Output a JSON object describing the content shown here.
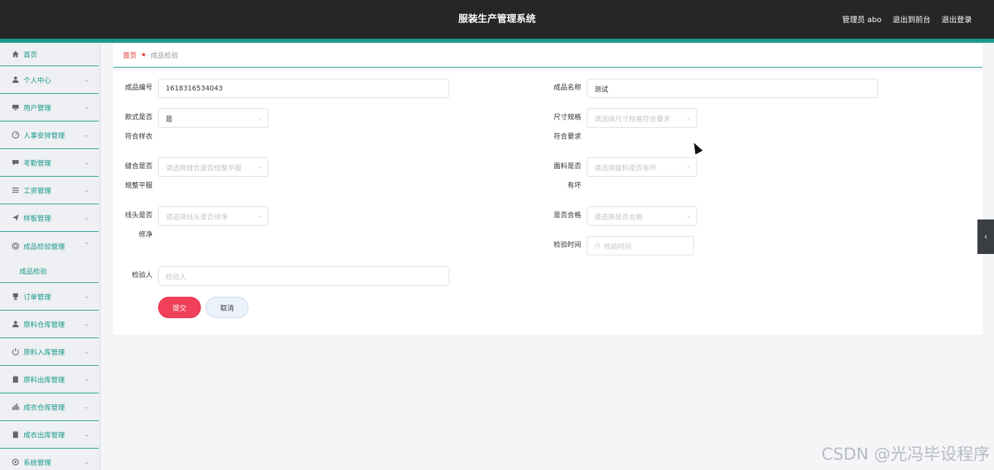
{
  "header": {
    "title": "服装生产管理系统",
    "links": [
      "管理员 abo",
      "退出到前台",
      "退出登录"
    ]
  },
  "sidebar": {
    "items": [
      {
        "label": "首页",
        "icon": "home-icon"
      },
      {
        "label": "个人中心",
        "icon": "user-icon"
      },
      {
        "label": "用户管理",
        "icon": "monitor-icon"
      },
      {
        "label": "人事安排管理",
        "icon": "dashboard-icon"
      },
      {
        "label": "考勤管理",
        "icon": "chat-icon"
      },
      {
        "label": "工资管理",
        "icon": "list-icon"
      },
      {
        "label": "样板管理",
        "icon": "send-icon"
      },
      {
        "label": "成品检验管理",
        "icon": "target-icon"
      },
      {
        "label": "订单管理",
        "icon": "cup-icon"
      },
      {
        "label": "原料仓库管理",
        "icon": "user-icon"
      },
      {
        "label": "原料入库管理",
        "icon": "power-icon"
      },
      {
        "label": "原料出库管理",
        "icon": "clipboard-icon"
      },
      {
        "label": "成衣仓库管理",
        "icon": "chart-icon"
      },
      {
        "label": "成衣出库管理",
        "icon": "clipboard-icon"
      },
      {
        "label": "系统管理",
        "icon": "gear-icon"
      }
    ],
    "submenu": {
      "label": "成品检验"
    }
  },
  "breadcrumb": {
    "home": "首页",
    "current": "成品检验"
  },
  "form": {
    "product_no": {
      "label": "成品编号",
      "value": "1618316534043"
    },
    "product_name": {
      "label": "成品名称",
      "value": "测试"
    },
    "style_match": {
      "label_1": "款式是否",
      "label_2": "符合样衣",
      "value": "是"
    },
    "size_spec": {
      "label_1": "尺寸规格",
      "label_2": "符合要求",
      "placeholder": "请选择尺寸规格符合要求"
    },
    "sewing": {
      "label_1": "缝合是否",
      "label_2": "规整平服",
      "placeholder": "请选择缝合是否规整平服"
    },
    "fabric": {
      "label_1": "面料是否",
      "label_2": "有坏",
      "placeholder": "请选择面料是否有坏"
    },
    "thread": {
      "label_1": "线头是否",
      "label_2": "修净",
      "placeholder": "请选择线头是否修净"
    },
    "qualified": {
      "label": "是否合格",
      "placeholder": "请选择是否合格"
    },
    "inspect_time": {
      "label": "检验时间",
      "placeholder": "检验时间"
    },
    "inspector": {
      "label": "检验人",
      "placeholder": "检验人"
    },
    "submit_label": "提交",
    "cancel_label": "取消"
  },
  "watermark": "CSDN @光冯毕设程序",
  "colors": {
    "accent": "#1a9a8a",
    "danger": "#f0405a",
    "topbar": "#262626"
  }
}
